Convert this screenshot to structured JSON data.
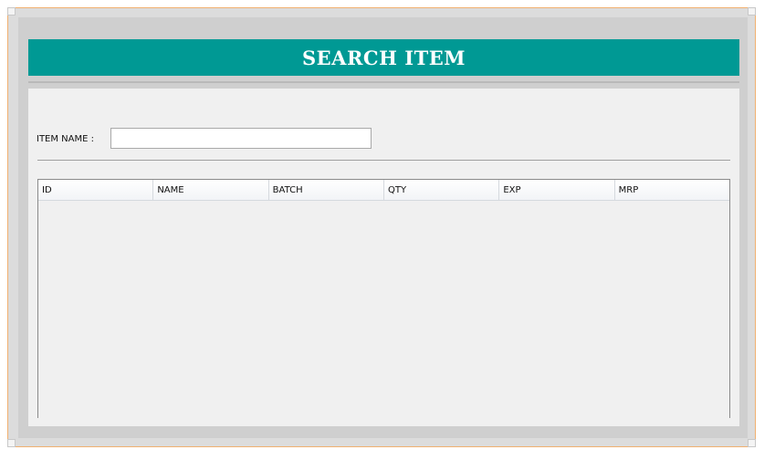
{
  "header": {
    "title": "SEARCH ITEM"
  },
  "search": {
    "label": "ITEM NAME :",
    "value": ""
  },
  "table": {
    "columns": [
      "ID",
      "NAME",
      "BATCH",
      "QTY",
      "EXP",
      "MRP"
    ],
    "rows": []
  },
  "colors": {
    "title_bar": "#009994",
    "frame_border": "#f0b070",
    "panel_bg": "#f0f0f0"
  }
}
